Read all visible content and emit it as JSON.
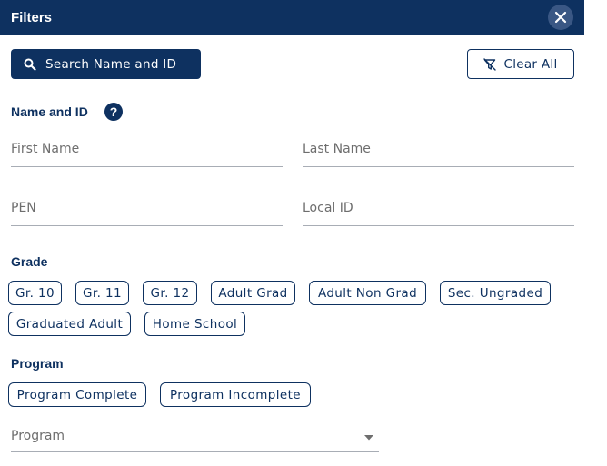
{
  "header": {
    "title": "Filters",
    "close_icon": "close-icon"
  },
  "toolbar": {
    "search_label": "Search Name and ID",
    "search_icon": "search-icon",
    "clear_label": "Clear All",
    "clear_icon": "filter-off-icon"
  },
  "name_section": {
    "label": "Name and ID",
    "help_glyph": "?",
    "first_name_placeholder": "First Name",
    "last_name_placeholder": "Last Name",
    "pen_placeholder": "PEN",
    "local_id_placeholder": "Local ID"
  },
  "grade_section": {
    "label": "Grade",
    "chips": [
      "Gr. 10",
      "Gr. 11",
      "Gr. 12",
      "Adult Grad",
      "Adult Non Grad",
      "Sec. Ungraded",
      "Graduated Adult",
      "Home School"
    ]
  },
  "program_section": {
    "label": "Program",
    "chips": [
      "Program Complete",
      "Program Incomplete"
    ],
    "select_placeholder": "Program"
  },
  "colors": {
    "primary": "#0e3160",
    "close_bg": "#3a5784",
    "divider": "#a8adb5"
  }
}
